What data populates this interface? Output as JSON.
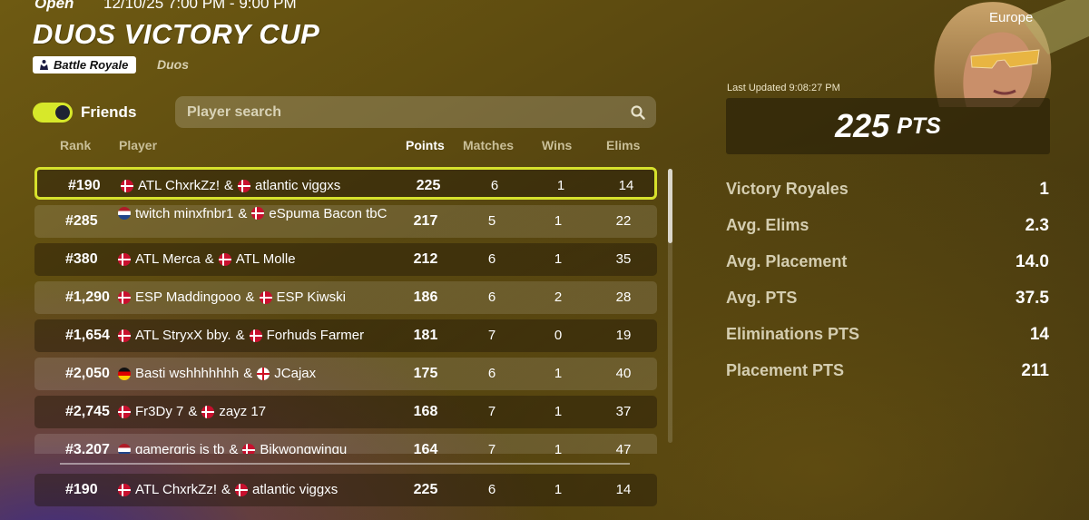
{
  "header": {
    "status": "Open",
    "time": "12/10/25 7:00 PM - 9:00 PM",
    "title": "DUOS VICTORY CUP",
    "mode_badge": "Battle Royale",
    "mode_sub": "Duos",
    "icons": {
      "mode": "crown-icon"
    }
  },
  "filters": {
    "friends_label": "Friends",
    "friends_on": true,
    "search_placeholder": "Player search",
    "search_value": ""
  },
  "columns": [
    "Rank",
    "Player",
    "Points",
    "Matches",
    "Wins",
    "Elims"
  ],
  "rows": [
    {
      "rank": "#190",
      "p1": "ATL ChxrkZz!",
      "f1": "dk",
      "p2": "atlantic viggxs",
      "f2": "dk",
      "points": "225",
      "matches": "6",
      "wins": "1",
      "elims": "14",
      "style": "hl"
    },
    {
      "rank": "#285",
      "p1": "twitch minxfnbr1",
      "f1": "nl",
      "p2": "eSpuma Bacon tbC",
      "f2": "dk",
      "points": "217",
      "matches": "5",
      "wins": "1",
      "elims": "22",
      "style": "light",
      "wrap": true
    },
    {
      "rank": "#380",
      "p1": "ATL Merca",
      "f1": "dk",
      "p2": "ATL Molle",
      "f2": "dk",
      "points": "212",
      "matches": "6",
      "wins": "1",
      "elims": "35",
      "style": "dark"
    },
    {
      "rank": "#1,290",
      "p1": "ESP Maddingooo",
      "f1": "dk",
      "p2": "ESP Kiwski",
      "f2": "dk",
      "points": "186",
      "matches": "6",
      "wins": "2",
      "elims": "28",
      "style": "light"
    },
    {
      "rank": "#1,654",
      "p1": "ATL StryxX bby.",
      "f1": "dk",
      "p2": "Forhuds Farmer",
      "f2": "dk",
      "points": "181",
      "matches": "7",
      "wins": "0",
      "elims": "19",
      "style": "dark"
    },
    {
      "rank": "#2,050",
      "p1": "Basti wshhhhhhh",
      "f1": "de",
      "p2": "JCajax",
      "f2": "en",
      "points": "175",
      "matches": "6",
      "wins": "1",
      "elims": "40",
      "style": "light"
    },
    {
      "rank": "#2,745",
      "p1": "Fr3Dy 7",
      "f1": "dk",
      "p2": "zayz 17",
      "f2": "dk",
      "points": "168",
      "matches": "7",
      "wins": "1",
      "elims": "37",
      "style": "dark"
    },
    {
      "rank": "#3,207",
      "p1": "gamergris is tb",
      "f1": "nl",
      "p2": "Bikwongwingu",
      "f2": "dk",
      "points": "164",
      "matches": "7",
      "wins": "1",
      "elims": "47",
      "style": "light"
    }
  ],
  "my_row": {
    "rank": "#190",
    "p1": "ATL ChxrkZz!",
    "f1": "dk",
    "p2": "atlantic viggxs",
    "f2": "dk",
    "points": "225",
    "matches": "6",
    "wins": "1",
    "elims": "14"
  },
  "panel": {
    "region": "Europe",
    "last_updated": "Last Updated 9:08:27 PM",
    "total_points": "225",
    "points_unit": "PTS",
    "stats": [
      {
        "label": "Victory Royales",
        "value": "1"
      },
      {
        "label": "Avg. Elims",
        "value": "2.3"
      },
      {
        "label": "Avg. Placement",
        "value": "14.0"
      },
      {
        "label": "Avg. PTS",
        "value": "37.5"
      },
      {
        "label": "Eliminations PTS",
        "value": "14"
      },
      {
        "label": "Placement PTS",
        "value": "211"
      }
    ]
  },
  "colors": {
    "accent": "#d6e12c",
    "background": "#5c4a10"
  }
}
